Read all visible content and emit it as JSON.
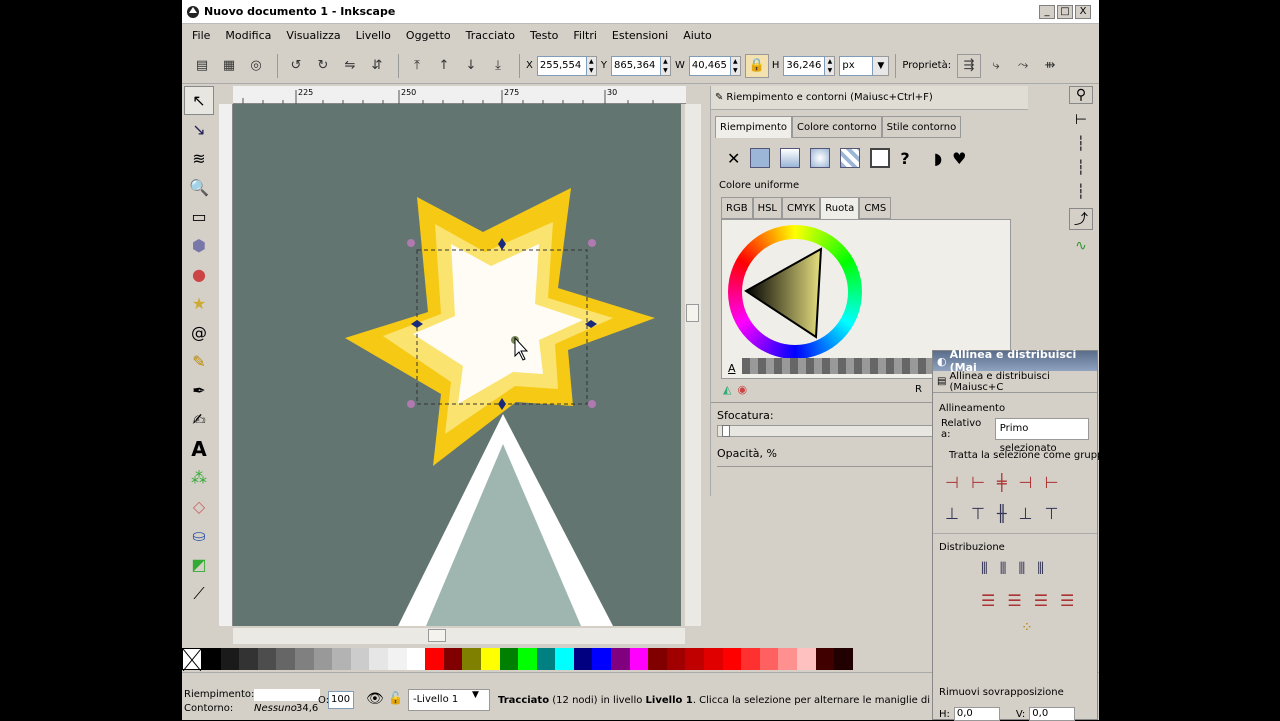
{
  "window": {
    "title": "Nuovo documento 1 - Inkscape",
    "buttons": [
      "_",
      "□",
      "X"
    ]
  },
  "menu": [
    "File",
    "Modifica",
    "Visualizza",
    "Livello",
    "Oggetto",
    "Tracciato",
    "Testo",
    "Filtri",
    "Estensioni",
    "Aiuto"
  ],
  "toolbar": {
    "x_label": "X",
    "x_value": "255,554",
    "y_label": "Y",
    "y_value": "865,364",
    "w_label": "W",
    "w_value": "40,465",
    "h_label": "H",
    "h_value": "36,246",
    "unit": "px",
    "properties_label": "Proprietà:"
  },
  "ruler": {
    "ticks": [
      "225",
      "250",
      "275",
      "30"
    ]
  },
  "tools": [
    "select-icon",
    "node-icon",
    "tweak-icon",
    "zoom-icon",
    "rect-icon",
    "box3d-icon",
    "ellipse-icon",
    "star-icon",
    "spiral-icon",
    "pencil-icon",
    "pen-icon",
    "calligraphy-icon",
    "text-icon",
    "spray-icon",
    "eraser-icon",
    "bucket-icon",
    "gradient-icon",
    "dropper-icon"
  ],
  "fill_panel": {
    "title": "Riempimento e contorni (Maiusc+Ctrl+F)",
    "tabs": [
      "Riempimento",
      "Colore contorno",
      "Stile contorno"
    ],
    "section": "Colore uniforme",
    "color_tabs": [
      "RGB",
      "HSL",
      "CMYK",
      "Ruota",
      "CMS"
    ],
    "alpha_label": "A",
    "blur_label": "Sfocatura:",
    "opacity_label": "Opacità, %",
    "r_label": "R"
  },
  "align_panel": {
    "title": "Allinea e distribuisci (Mai",
    "subtitle": "Allinea e distribuisci (Maiusc+C",
    "section_align": "Allineamento",
    "relative_label": "Relativo a:",
    "relative_value": "Primo selezionato",
    "group_label": "Tratta la selezione come grupp",
    "section_distribute": "Distribuzione",
    "section_overlap": "Rimuovi sovrapposizione",
    "h_label": "H:",
    "h_value": "0,0",
    "v_label": "V:",
    "v_value": "0,0"
  },
  "palette": [
    "#ffffff",
    "#000000",
    "#1a1a1a",
    "#333333",
    "#4d4d4d",
    "#666666",
    "#808080",
    "#999999",
    "#b3b3b3",
    "#cccccc",
    "#e6e6e6",
    "#f2f2f2",
    "#ffffff",
    "#ff0000",
    "#800000",
    "#808000",
    "#ffff00",
    "#008000",
    "#00ff00",
    "#008080",
    "#00ffff",
    "#000080",
    "#0000ff",
    "#800080",
    "#ff00ff",
    "#800000",
    "#a00000",
    "#c00000",
    "#e00000",
    "#ff0000",
    "#ff3030",
    "#ff6060",
    "#ff9090",
    "#ffc0c0",
    "#400000",
    "#200000"
  ],
  "status": {
    "fill_label": "Riempimento:",
    "stroke_label": "Contorno:",
    "stroke_value": "Nessuno",
    "stroke_width": "34,6",
    "opacity_label": "O:",
    "opacity_value": "100",
    "layer": "-Livello 1",
    "message_bold": "Tracciato",
    "message_rest": "(12 nodi) in livello",
    "message_layer": "Livello 1",
    "message_end": ". Clicca la selezione per alternare le maniglie di ridime"
  }
}
